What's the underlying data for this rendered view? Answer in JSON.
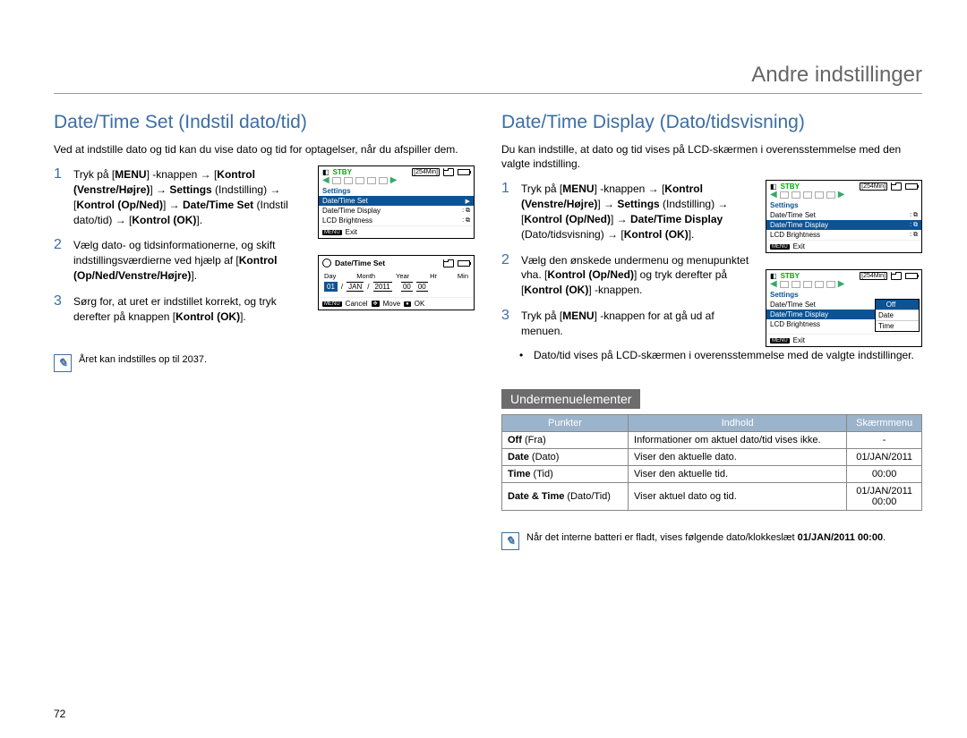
{
  "header": {
    "title": "Andre indstillinger"
  },
  "page_number": "72",
  "left": {
    "heading": "Date/Time Set (Indstil dato/tid)",
    "intro": "Ved at indstille dato og tid kan du vise dato og tid for optagelser, når du afspiller dem.",
    "steps": [
      {
        "num": "1",
        "html": "Tryk på [<b>MENU</b>] -knappen → [<b>Kontrol (Venstre/Højre)</b>] → <b>Settings</b> (Indstilling) → [<b>Kontrol (Op/Ned)</b>] → <b>Date/Time Set</b> (Indstil dato/tid) → [<b>Kontrol (OK)</b>]."
      },
      {
        "num": "2",
        "html": "Vælg dato- og tidsinformationerne, og skift indstillingsværdierne ved hjælp af [<b>Kontrol (Op/Ned/Venstre/Højre)</b>]."
      },
      {
        "num": "3",
        "html": "Sørg for, at uret er indstillet korrekt, og tryk derefter på knappen [<b>Kontrol (OK)</b>]."
      }
    ],
    "note": "Året kan indstilles op til 2037.",
    "mini1": {
      "stby": "STBY",
      "time": "[254Min]",
      "settings": "Settings",
      "rows": [
        "Date/Time Set",
        "Date/Time Display",
        "LCD Brightness"
      ],
      "highlight_index": 0,
      "footer": [
        "MENU",
        "Exit"
      ]
    },
    "mini2": {
      "title": "Date/Time Set",
      "cols": [
        "Day",
        "Month",
        "Year",
        "Hr",
        "Min"
      ],
      "vals": [
        "01",
        "JAN",
        "2011",
        "00",
        "00"
      ],
      "footer": [
        "MENU",
        "Cancel",
        "Move",
        "OK"
      ]
    }
  },
  "right": {
    "heading": "Date/Time Display (Dato/tidsvisning)",
    "intro": "Du kan indstille, at dato og tid vises på LCD-skærmen i overensstemmelse med den valgte indstilling.",
    "steps": [
      {
        "num": "1",
        "html": "Tryk på [<b>MENU</b>] -knappen → [<b>Kontrol (Venstre/Højre)</b>] → <b>Settings</b> (Indstilling) → [<b>Kontrol (Op/Ned)</b>] → <b>Date/Time Display</b> (Dato/tidsvisning) → [<b>Kontrol (OK)</b>]."
      },
      {
        "num": "2",
        "html": "Vælg den ønskede undermenu og menupunktet vha. [<b>Kontrol (Op/Ned)</b>] og tryk derefter på [<b>Kontrol (OK)</b>] -knappen."
      },
      {
        "num": "3",
        "html": "Tryk på [<b>MENU</b>] -knappen for at gå ud af menuen."
      }
    ],
    "bullet": "Dato/tid vises på LCD-skærmen i overensstemmelse med de valgte indstillinger.",
    "mini1": {
      "stby": "STBY",
      "time": "[254Min]",
      "settings": "Settings",
      "rows": [
        "Date/Time Set",
        "Date/Time Display",
        "LCD Brightness"
      ],
      "highlight_index": 1,
      "footer": [
        "MENU",
        "Exit"
      ]
    },
    "mini2": {
      "stby": "STBY",
      "time": "[254Min]",
      "settings": "Settings",
      "rows": [
        "Date/Time Set",
        "Date/Time Display",
        "LCD Brightness"
      ],
      "submenu": [
        "Off",
        "Date",
        "Time"
      ],
      "footer": [
        "MENU",
        "Exit"
      ]
    },
    "sub_heading": "Undermenuelementer",
    "table": {
      "headers": [
        "Punkter",
        "Indhold",
        "Skærmmenu"
      ],
      "rows": [
        {
          "p": "<b>Off</b> (Fra)",
          "i": "Informationer om aktuel dato/tid vises ikke.",
          "s": "-"
        },
        {
          "p": "<b>Date</b> (Dato)",
          "i": "Viser den aktuelle dato.",
          "s": "01/JAN/2011"
        },
        {
          "p": "<b>Time</b> (Tid)",
          "i": "Viser den aktuelle tid.",
          "s": "00:00"
        },
        {
          "p": "<b>Date & Time</b> (Dato/Tid)",
          "i": "Viser aktuel dato og tid.",
          "s": "01/JAN/2011<br>00:00"
        }
      ]
    },
    "note": "Når det interne batteri er fladt, vises følgende dato/klokkeslæt <b>01/JAN/2011 00:00</b>."
  }
}
